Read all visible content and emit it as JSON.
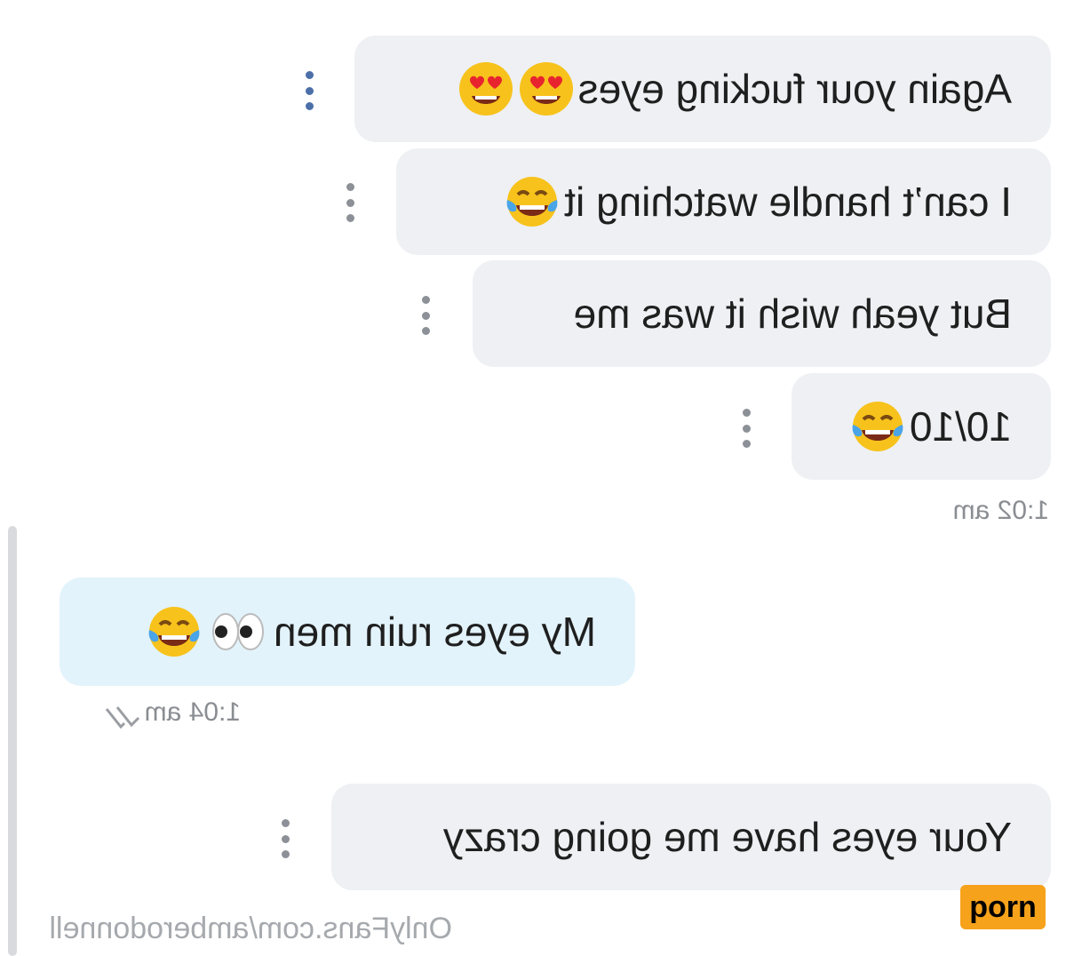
{
  "messages": [
    {
      "text": "Again your fucking eyes",
      "emojis": [
        "heart-eyes",
        "heart-eyes"
      ],
      "side": "received"
    },
    {
      "text": "I can’t handle watching it",
      "emojis": [
        "tears-of-joy"
      ],
      "side": "received"
    },
    {
      "text": "But yeah wish it was me",
      "emojis": [],
      "side": "received"
    },
    {
      "text": "10/10",
      "emojis": [
        "tears-of-joy"
      ],
      "side": "received"
    },
    {
      "text": "My eyes ruin men",
      "emojis": [
        "eyes",
        "tears-of-joy"
      ],
      "side": "sent"
    },
    {
      "text": "Your eyes have me going crazy",
      "emojis": [],
      "side": "received"
    }
  ],
  "timestamps": {
    "received_group": "1:02 am",
    "sent": "1:04 am"
  },
  "watermarks": {
    "onlyfans": "OnlyFans.com/amberodonnell",
    "badge": "porn"
  },
  "colors": {
    "received_bubble": "#eef0f3",
    "sent_bubble": "#e3f3fb",
    "badge": "#f7a21b",
    "menu_dots_active": "#4b6fa8"
  }
}
